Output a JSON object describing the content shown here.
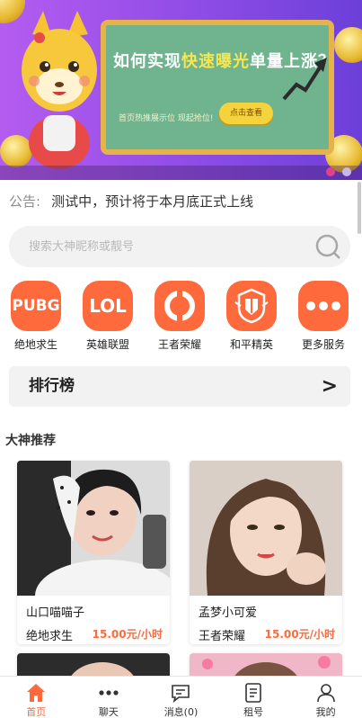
{
  "banner": {
    "title_part1": "如何实现",
    "title_highlight": "快速曝光",
    "title_part2": "单量上涨？",
    "sub_text": "首页热推展示位 现起抢位!",
    "button_label": "点击查看",
    "dots": 2,
    "active_dot": 0
  },
  "notice": {
    "label": "公告:",
    "text": "测试中，预计将于本月底正式上线"
  },
  "search": {
    "placeholder": "搜索大神昵称或靓号"
  },
  "categories": [
    {
      "label": "绝地求生",
      "icon": "pubg-icon",
      "icon_text": "PUBG"
    },
    {
      "label": "英雄联盟",
      "icon": "lol-icon",
      "icon_text": "LOL"
    },
    {
      "label": "王者荣耀",
      "icon": "honor-of-kings-icon",
      "icon_text": ""
    },
    {
      "label": "和平精英",
      "icon": "peace-elite-icon",
      "icon_text": ""
    },
    {
      "label": "更多服务",
      "icon": "more-dots-icon",
      "icon_text": ""
    }
  ],
  "ranking": {
    "label": "排行榜",
    "arrow": ">"
  },
  "section_title": "大神推荐",
  "cards": [
    {
      "name": "山口喵喵子",
      "game": "绝地求生",
      "price": "15.00元/小时"
    },
    {
      "name": "孟梦小可爱",
      "game": "王者荣耀",
      "price": "15.00元/小时"
    }
  ],
  "tabbar": [
    {
      "label": "首页",
      "icon": "home-icon",
      "active": true
    },
    {
      "label": "聊天",
      "icon": "chat-dots-icon",
      "active": false
    },
    {
      "label": "消息(0)",
      "icon": "message-icon",
      "active": false
    },
    {
      "label": "租号",
      "icon": "rent-account-icon",
      "active": false
    },
    {
      "label": "我的",
      "icon": "profile-icon",
      "active": false
    }
  ],
  "colors": {
    "accent": "#ff6a3d",
    "banner_start": "#b45cf0",
    "banner_end": "#6c3fd9"
  }
}
